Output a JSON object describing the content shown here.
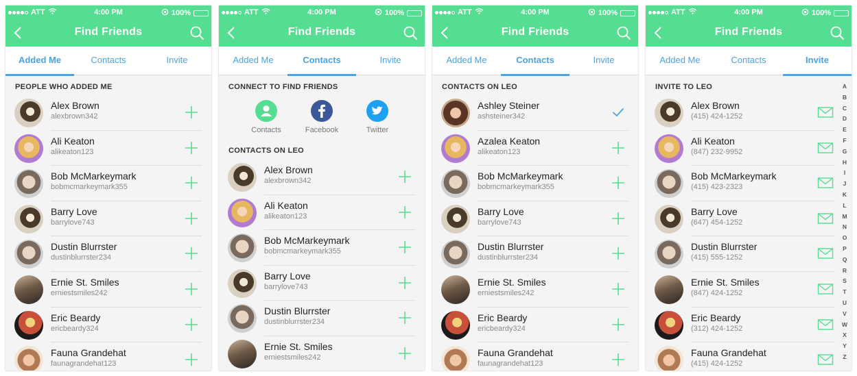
{
  "status": {
    "carrier": "ATT",
    "time": "4:00 PM",
    "battery": "100%"
  },
  "nav": {
    "title": "Find Friends"
  },
  "tabs": [
    "Added Me",
    "Contacts",
    "Invite"
  ],
  "colors": {
    "brand": "#55dd91",
    "accent": "#4aa3e4",
    "facebook": "#3b5998",
    "twitter": "#1da1f2"
  },
  "screens": [
    {
      "active_tab": 0,
      "section": "PEOPLE WHO ADDED ME",
      "rows": [
        {
          "name": "Alex Brown",
          "sub": "alexbrown342",
          "action": "plus-icon"
        },
        {
          "name": "Ali Keaton",
          "sub": "alikeaton123",
          "action": "plus-icon"
        },
        {
          "name": "Bob McMarkeymark",
          "sub": "bobmcmarkeymark355",
          "action": "plus-icon"
        },
        {
          "name": "Barry Love",
          "sub": "barrylove743",
          "action": "plus-icon"
        },
        {
          "name": "Dustin Blurrster",
          "sub": "dustinblurrster234",
          "action": "plus-icon"
        },
        {
          "name": "Ernie St. Smiles",
          "sub": "erniestsmiles242",
          "action": "plus-icon"
        },
        {
          "name": "Eric Beardy",
          "sub": "ericbeardy324",
          "action": "plus-icon"
        },
        {
          "name": "Fauna Grandehat",
          "sub": "faunagrandehat123",
          "action": "plus-icon"
        }
      ]
    },
    {
      "active_tab": 1,
      "connect_section": "CONNECT TO FIND FRIENDS",
      "connect": [
        {
          "label": "Contacts",
          "icon": "person-icon"
        },
        {
          "label": "Facebook",
          "icon": "facebook-icon"
        },
        {
          "label": "Twitter",
          "icon": "twitter-icon"
        }
      ],
      "section": "CONTACTS ON LEO",
      "rows": [
        {
          "name": "Alex Brown",
          "sub": "alexbrown342",
          "action": "plus-icon"
        },
        {
          "name": "Ali Keaton",
          "sub": "alikeaton123",
          "action": "plus-icon"
        },
        {
          "name": "Bob McMarkeymark",
          "sub": "bobmcmarkeymark355",
          "action": "plus-icon"
        },
        {
          "name": "Barry Love",
          "sub": "barrylove743",
          "action": "plus-icon"
        },
        {
          "name": "Dustin Blurrster",
          "sub": "dustinblurrster234",
          "action": "plus-icon"
        },
        {
          "name": "Ernie St. Smiles",
          "sub": "erniestsmiles242",
          "action": "plus-icon"
        }
      ]
    },
    {
      "active_tab": 1,
      "section": "CONTACTS ON LEO",
      "rows": [
        {
          "name": "Ashley Steiner",
          "sub": "ashsteiner342",
          "action": "check-icon"
        },
        {
          "name": "Azalea Keaton",
          "sub": "alikeaton123",
          "action": "plus-icon"
        },
        {
          "name": "Bob McMarkeymark",
          "sub": "bobmcmarkeymark355",
          "action": "plus-icon"
        },
        {
          "name": "Barry Love",
          "sub": "barrylove743",
          "action": "plus-icon"
        },
        {
          "name": "Dustin Blurrster",
          "sub": "dustinblurrster234",
          "action": "plus-icon"
        },
        {
          "name": "Ernie St. Smiles",
          "sub": "erniestsmiles242",
          "action": "plus-icon"
        },
        {
          "name": "Eric Beardy",
          "sub": "ericbeardy324",
          "action": "plus-icon"
        },
        {
          "name": "Fauna Grandehat",
          "sub": "faunagrandehat123",
          "action": "plus-icon"
        }
      ]
    },
    {
      "active_tab": 2,
      "section": "INVITE TO LEO",
      "rows": [
        {
          "name": "Alex Brown",
          "sub": "(415) 424-1252",
          "action": "mail-icon"
        },
        {
          "name": "Ali Keaton",
          "sub": "(847) 232-9952",
          "action": "mail-icon"
        },
        {
          "name": "Bob McMarkeymark",
          "sub": "(415) 423-2323",
          "action": "mail-icon"
        },
        {
          "name": "Barry Love",
          "sub": "(647) 454-1252",
          "action": "mail-icon"
        },
        {
          "name": "Dustin Blurrster",
          "sub": "(415) 555-1252",
          "action": "mail-icon"
        },
        {
          "name": "Ernie St. Smiles",
          "sub": "(847) 424-1252",
          "action": "mail-icon"
        },
        {
          "name": "Eric Beardy",
          "sub": "(312) 424-1252",
          "action": "mail-icon"
        },
        {
          "name": "Fauna Grandehat",
          "sub": "(415) 424-1252",
          "action": "mail-icon"
        }
      ],
      "alphabet": [
        "A",
        "B",
        "C",
        "D",
        "E",
        "F",
        "G",
        "H",
        "I",
        "J",
        "K",
        "L",
        "M",
        "N",
        "O",
        "P",
        "Q",
        "R",
        "S",
        "T",
        "U",
        "V",
        "W",
        "X",
        "Y",
        "Z"
      ]
    }
  ]
}
